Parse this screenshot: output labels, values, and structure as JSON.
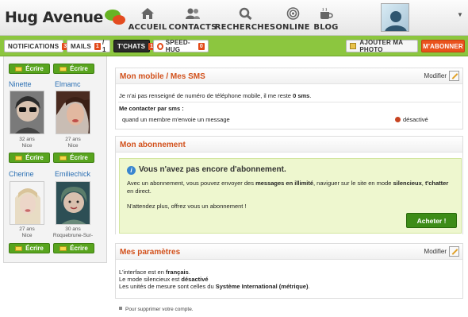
{
  "header": {
    "logo_text": "Hug Avenue",
    "nav": [
      {
        "label": "ACCUEIL",
        "icon": "home-icon"
      },
      {
        "label": "CONTACTS",
        "icon": "contacts-icon"
      },
      {
        "label": "RECHERCHES",
        "icon": "search-icon"
      },
      {
        "label": "ONLINE",
        "icon": "online-icon"
      },
      {
        "label": "BLOG",
        "icon": "blog-icon"
      }
    ]
  },
  "subbar": {
    "notifications": {
      "label": "NOTIFICATIONS",
      "count": "3"
    },
    "mails": {
      "label": "MAILS",
      "count": "1",
      "total": "/ 1"
    },
    "tchats": {
      "label": "T'CHATS",
      "count": "1"
    },
    "speedhug": {
      "label": "SPEED-HUG",
      "count": "0"
    },
    "add_photo": "AJOUTER MA PHOTO",
    "subscribe": "M'ABONNER"
  },
  "sidebar": {
    "write_label": "Écrire",
    "members": [
      {
        "name": "Ninette",
        "age": "32 ans",
        "city": "Nice"
      },
      {
        "name": "Elmamc",
        "age": "27 ans",
        "city": "Nice"
      },
      {
        "name": "Cherine",
        "age": "27 ans",
        "city": "Nice"
      },
      {
        "name": "Emiliechick",
        "age": "30 ans",
        "city": "Roquebrune-Sur-"
      }
    ]
  },
  "mobile": {
    "title": "Mon mobile / Mes SMS",
    "modify": "Modifier",
    "line_pre": "Je n'ai pas renseigné de numéro de téléphone mobile, il me reste",
    "sms_count": "0 sms",
    "line_post": ".",
    "contact_heading": "Me contacter par sms :",
    "contact_option": "quand un membre m'envoie un message",
    "status": "désactivé"
  },
  "subscription": {
    "title": "Mon abonnement",
    "notice_title": "Vous n'avez pas encore d'abonnement.",
    "p1_a": "Avec un abonnement, vous pouvez envoyer des",
    "p1_b": "messages en illimité",
    "p1_c": ", naviguer sur le site en mode",
    "p1_d": "silencieux",
    "p1_e": ",",
    "p1_f": "t'chatter",
    "p1_g": "en direct.",
    "p2": "N'attendez plus, offrez vous un abonnement !",
    "buy": "Acheter !"
  },
  "settings": {
    "title": "Mes paramètres",
    "modify": "Modifier",
    "l1_a": "L'interface est en",
    "l1_b": "français",
    "l1_c": ".",
    "l2_a": "Le mode silencieux est",
    "l2_b": "désactivé",
    "l3_a": "Les unités de mesure sont celles du",
    "l3_b": "Système International (métrique)",
    "l3_c": "."
  },
  "footer": {
    "delete_account": "Pour supprimer votre compte."
  }
}
